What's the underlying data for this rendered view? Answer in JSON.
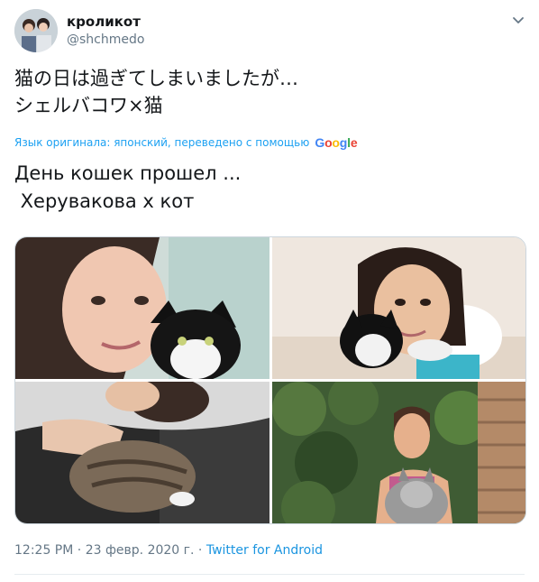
{
  "user": {
    "display_name": "кроликот",
    "handle": "@shchmedo"
  },
  "tweet": {
    "text_line1": "猫の日は過ぎてしまいましたが…",
    "text_line2": "シェルバコワ×猫",
    "translation_label": "Язык оригинала: японский, переведено с помощью",
    "translation_provider": "Google",
    "translated_line1": "День кошек прошел ...",
    "translated_line2": " Херувакова х кот"
  },
  "meta": {
    "time": "12:25 PM",
    "separator": "·",
    "date": "23 февр. 2020 г.",
    "source": "Twitter for Android"
  },
  "icons": {
    "menu": "chevron-down-icon",
    "avatar": "avatar-photo"
  },
  "colors": {
    "link": "#1da1f2",
    "secondary_text": "#657786",
    "border": "#ccd6dd"
  }
}
